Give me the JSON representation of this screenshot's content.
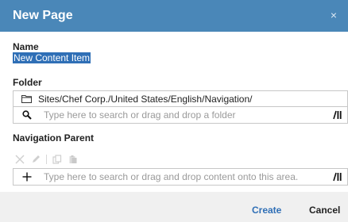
{
  "dialog": {
    "title": "New Page",
    "close_label": "×"
  },
  "name": {
    "label": "Name",
    "value": "New Content Item"
  },
  "folder": {
    "label": "Folder",
    "path": "Sites/Chef Corp./United States/English/Navigation/",
    "search_placeholder": "Type here to search or drag and drop a folder"
  },
  "navigation_parent": {
    "label": "Navigation Parent",
    "search_placeholder": "Type here to search or drag and drop content onto this area."
  },
  "buttons": {
    "create": "Create",
    "cancel": "Cancel"
  },
  "colors": {
    "title_bar": "#4a87b8",
    "accent": "#2f6fb6"
  },
  "icons": [
    "close-icon",
    "folder-icon",
    "search-icon",
    "library-icon",
    "remove-icon",
    "edit-icon",
    "copy-icon",
    "paste-icon",
    "add-icon"
  ]
}
